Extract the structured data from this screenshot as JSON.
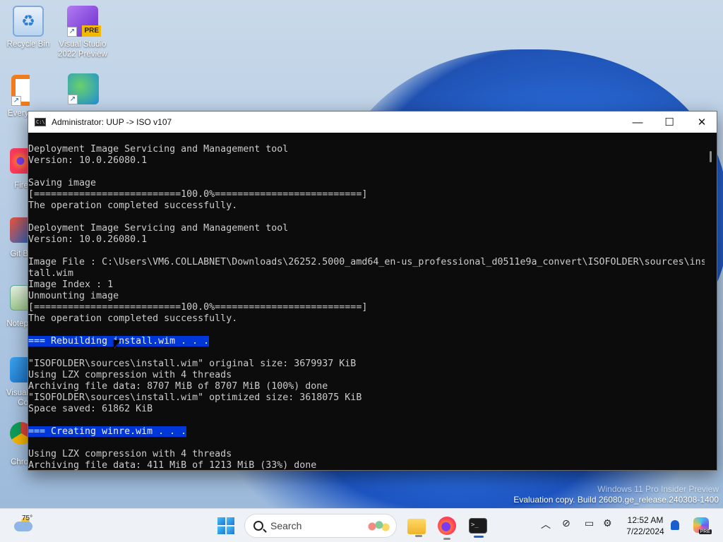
{
  "desktop": {
    "icons": [
      {
        "label": "Recycle Bin"
      },
      {
        "label": "Visual Studio 2022 Preview",
        "badge": "PRE"
      },
      {
        "label": "Every"
      },
      {
        "label": "Fire"
      },
      {
        "label": "Git B"
      },
      {
        "label": "Notep"
      },
      {
        "label": "Visual Co"
      },
      {
        "label": "Chro"
      }
    ]
  },
  "window": {
    "title": "Administrator:  UUP -> ISO v107",
    "controls": {
      "minimize": "—",
      "maximize": "☐",
      "close": "✕"
    },
    "lines": [
      {
        "text": "Deployment Image Servicing and Management tool"
      },
      {
        "text": "Version: 10.0.26080.1"
      },
      {
        "text": ""
      },
      {
        "text": "Saving image"
      },
      {
        "text": "[==========================100.0%==========================]"
      },
      {
        "text": "The operation completed successfully."
      },
      {
        "text": ""
      },
      {
        "text": "Deployment Image Servicing and Management tool"
      },
      {
        "text": "Version: 10.0.26080.1"
      },
      {
        "text": ""
      },
      {
        "text": "Image File : C:\\Users\\VM6.COLLABNET\\Downloads\\26252.5000_amd64_en-us_professional_d0511e9a_convert\\ISOFOLDER\\sources\\ins"
      },
      {
        "text": "tall.wim"
      },
      {
        "text": "Image Index : 1"
      },
      {
        "text": "Unmounting image"
      },
      {
        "text": "[==========================100.0%==========================]"
      },
      {
        "text": "The operation completed successfully."
      },
      {
        "text": ""
      },
      {
        "text": "=== Rebuilding install.wim . . .",
        "highlight": true
      },
      {
        "text": ""
      },
      {
        "text": "\"ISOFOLDER\\sources\\install.wim\" original size: 3679937 KiB"
      },
      {
        "text": "Using LZX compression with 4 threads"
      },
      {
        "text": "Archiving file data: 8707 MiB of 8707 MiB (100%) done"
      },
      {
        "text": "\"ISOFOLDER\\sources\\install.wim\" optimized size: 3618075 KiB"
      },
      {
        "text": "Space saved: 61862 KiB"
      },
      {
        "text": ""
      },
      {
        "text": "=== Creating winre.wim . . .",
        "highlight": true
      },
      {
        "text": ""
      },
      {
        "text": "Using LZX compression with 4 threads"
      },
      {
        "text": "Archiving file data: 411 MiB of 1213 MiB (33%) done"
      }
    ]
  },
  "watermark": {
    "line1": "Windows 11 Pro Insider Preview",
    "line2": "Evaluation copy. Build 26080.ge_release.240308-1400"
  },
  "taskbar": {
    "weather_temp": "75°",
    "search_placeholder": "Search",
    "terminal_glyph": ">_",
    "time": "12:52 AM",
    "date": "7/22/2024",
    "copilot_badge": "PRE",
    "tray_icons": [
      "chevron-up-icon",
      "network-off-icon",
      "display-icon",
      "settings-sync-icon"
    ]
  }
}
